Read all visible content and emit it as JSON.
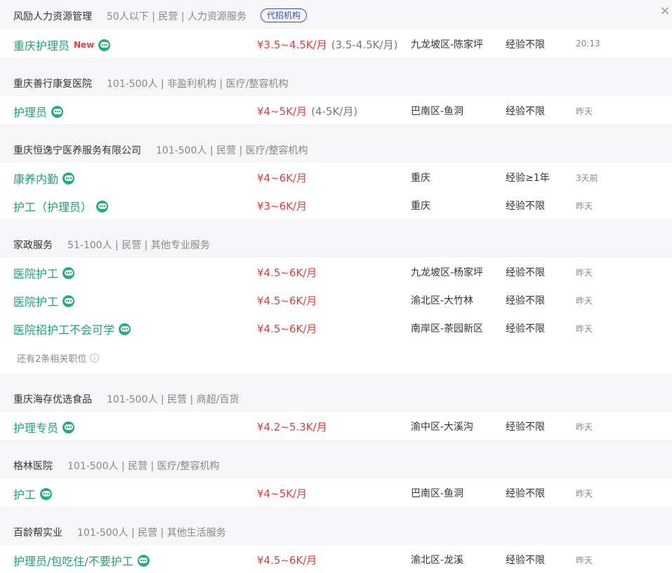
{
  "close_icon_glyph": "×",
  "more_icon_glyph": "↓",
  "groups": [
    {
      "company": "风励人力资源管理",
      "meta": "50人以下 | 民营 | 人力资源服务",
      "badge": "代招机构",
      "jobs": [
        {
          "title": "重庆护理员",
          "new": "New",
          "salary": "¥3.5~4.5K/月",
          "range": "(3.5-4.5K/月)",
          "location": "九龙坡区-陈家坪",
          "experience": "经验不限",
          "time": "20:13"
        }
      ]
    },
    {
      "company": "重庆善行康复医院",
      "meta": "101-500人 | 非盈利机构 | 医疗/整容机构",
      "jobs": [
        {
          "title": "护理员",
          "salary": "¥4~5K/月",
          "range": "(4-5K/月)",
          "location": "巴南区-鱼洞",
          "experience": "经验不限",
          "time": "昨天"
        }
      ]
    },
    {
      "company": "重庆恒逸宁医养服务有限公司",
      "meta": "101-500人 | 民营 | 医疗/整容机构",
      "jobs": [
        {
          "title": "康养内勤",
          "salary": "¥4~6K/月",
          "location": "重庆",
          "experience": "经验≥1年",
          "time": "3天前"
        },
        {
          "title": "护工（护理员）",
          "salary": "¥3~6K/月",
          "location": "重庆",
          "experience": "经验不限",
          "time": "昨天"
        }
      ]
    },
    {
      "company": "家政服务",
      "meta": "51-100人 | 民营 | 其他专业服务",
      "jobs": [
        {
          "title": "医院护工",
          "salary": "¥4.5~6K/月",
          "location": "九龙坡区-杨家坪",
          "experience": "经验不限",
          "time": "昨天"
        },
        {
          "title": "医院护工",
          "salary": "¥4.5~6K/月",
          "location": "渝北区-大竹林",
          "experience": "经验不限",
          "time": "昨天"
        },
        {
          "title": "医院招护工不会可学",
          "salary": "¥4.5~6K/月",
          "location": "南岸区-茶园新区",
          "experience": "经验不限",
          "time": "昨天"
        }
      ],
      "more": "还有2条相关职位"
    },
    {
      "company": "重庆海存优选食品",
      "meta": "101-500人 | 民营 | 商超/百货",
      "jobs": [
        {
          "title": "护理专员",
          "salary": "¥4.2~5.3K/月",
          "location": "渝中区-大溪沟",
          "experience": "经验不限",
          "time": "昨天"
        }
      ]
    },
    {
      "company": "格林医院",
      "meta": "101-500人 | 民营 | 医疗/整容机构",
      "jobs": [
        {
          "title": "护工",
          "salary": "¥4~5K/月",
          "location": "巴南区-鱼洞",
          "experience": "经验不限",
          "time": "昨天"
        }
      ]
    },
    {
      "company": "百龄帮实业",
      "meta": "101-500人 | 民营 | 其他生活服务",
      "jobs": [
        {
          "title": "护理员/包吃住/不要护工",
          "salary": "¥4.5~6K/月",
          "location": "渝北区-龙溪",
          "experience": "经验不限",
          "time": "昨天"
        }
      ]
    }
  ]
}
